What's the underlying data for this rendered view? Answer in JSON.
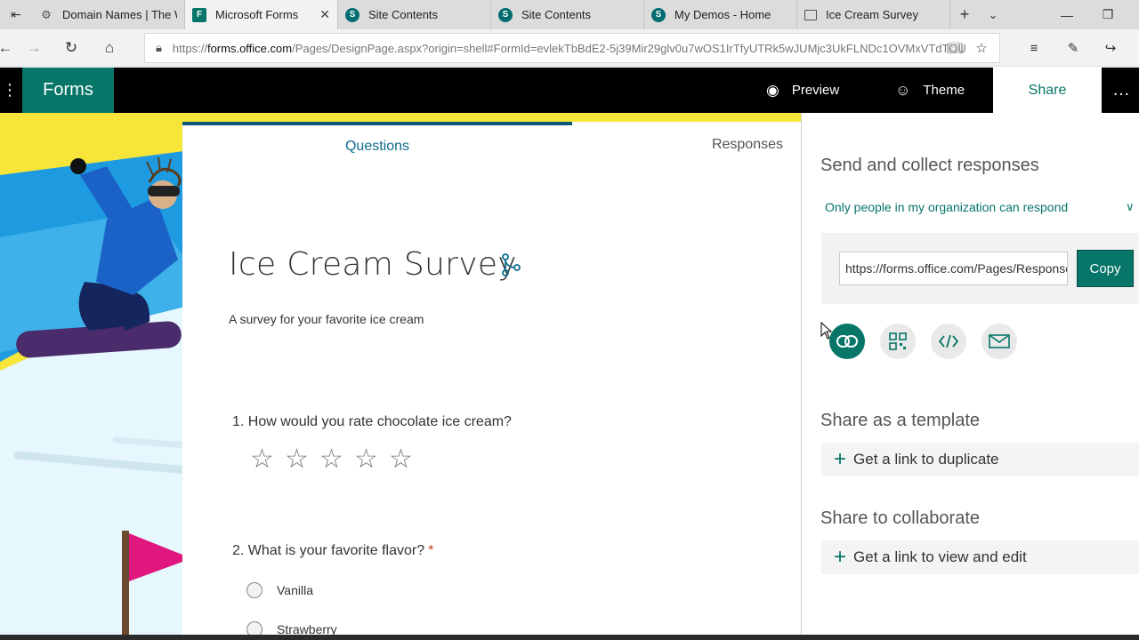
{
  "browser": {
    "tabs": [
      {
        "label": "Domain Names | The W",
        "icon": "lightbulb-icon"
      },
      {
        "label": "Microsoft Forms",
        "icon": "forms-icon",
        "active": true
      },
      {
        "label": "Site Contents",
        "icon": "sharepoint-icon"
      },
      {
        "label": "Site Contents",
        "icon": "sharepoint-icon"
      },
      {
        "label": "My Demos - Home",
        "icon": "sharepoint-icon"
      },
      {
        "label": "Ice Cream Survey",
        "icon": "window-icon"
      }
    ],
    "url_prefix": "https://",
    "url_domain": "forms.office.com",
    "url_rest": "/Pages/DesignPage.aspx?origin=shell#FormId=evlekTbBdE2-5j39Mir29glv0u7wOS1IrTfyUTRk5wJUMjc3UkFLNDc1OVMxVTdTOU"
  },
  "app": {
    "brand": "Forms",
    "preview_label": "Preview",
    "theme_label": "Theme",
    "share_label": "Share",
    "more_label": "…"
  },
  "form": {
    "tab_questions": "Questions",
    "tab_responses": "Responses",
    "title": "Ice Cream Survey",
    "description": "A survey for your favorite ice cream",
    "q1": "1. How would you rate chocolate ice cream?",
    "q1_rating_max": 5,
    "q2": "2. What is your favorite flavor?",
    "q2_required_mark": "*",
    "q2_options": [
      "Vanilla",
      "Strawberry"
    ]
  },
  "share_panel": {
    "heading_send": "Send and collect responses",
    "audience": "Only people in my organization can respond",
    "link_value": "https://forms.office.com/Pages/ResponsePage.aspx",
    "copy_label": "Copy",
    "heading_template": "Share as a template",
    "duplicate_link": "Get a link to duplicate",
    "heading_collaborate": "Share to collaborate",
    "edit_link": "Get a link to view and edit",
    "accent_color": "#077568"
  }
}
